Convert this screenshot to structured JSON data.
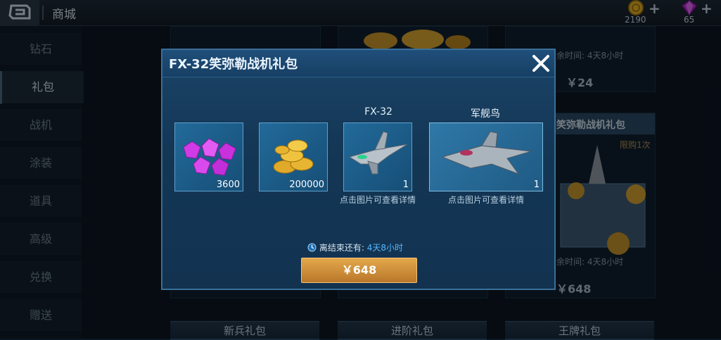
{
  "topbar": {
    "title": "商城",
    "coins": "2190",
    "gems": "65",
    "plus": "+"
  },
  "sidebar": {
    "items": [
      {
        "label": "钻石"
      },
      {
        "label": "礼包"
      },
      {
        "label": "战机"
      },
      {
        "label": "涂装"
      },
      {
        "label": "道具"
      },
      {
        "label": "高级"
      },
      {
        "label": "兑换"
      },
      {
        "label": "赠送"
      }
    ]
  },
  "background": {
    "card1_timer": "余时间: 4天8小时",
    "card1_price": "￥24",
    "card2_title": "笑弥勒战机礼包",
    "card2_limit": "限购1次",
    "card2_timer": "余时间: 4天8小时",
    "card2_price": "￥648",
    "tabs": [
      "新兵礼包",
      "进阶礼包",
      "王牌礼包"
    ]
  },
  "modal": {
    "title": "FX-32笑弥勒战机礼包",
    "close": "✕",
    "items": [
      {
        "name": "",
        "count": "3600",
        "icon": "gems-icon",
        "hint": ""
      },
      {
        "name": "",
        "count": "200000",
        "icon": "coins-icon",
        "hint": ""
      },
      {
        "name": "FX-32",
        "count": "1",
        "icon": "fighter-jet-icon",
        "hint": "点击图片可查看详情"
      },
      {
        "name": "军舰鸟",
        "count": "1",
        "icon": "frigatebird-jet-icon",
        "hint": "点击图片可查看详情"
      }
    ],
    "timer_label": "离结束还有:",
    "timer_value": "4天8小时",
    "price": "￥648"
  },
  "colors": {
    "accent_blue": "#58b6ff",
    "button_gold": "#d4913a",
    "panel": "#163a5a"
  }
}
